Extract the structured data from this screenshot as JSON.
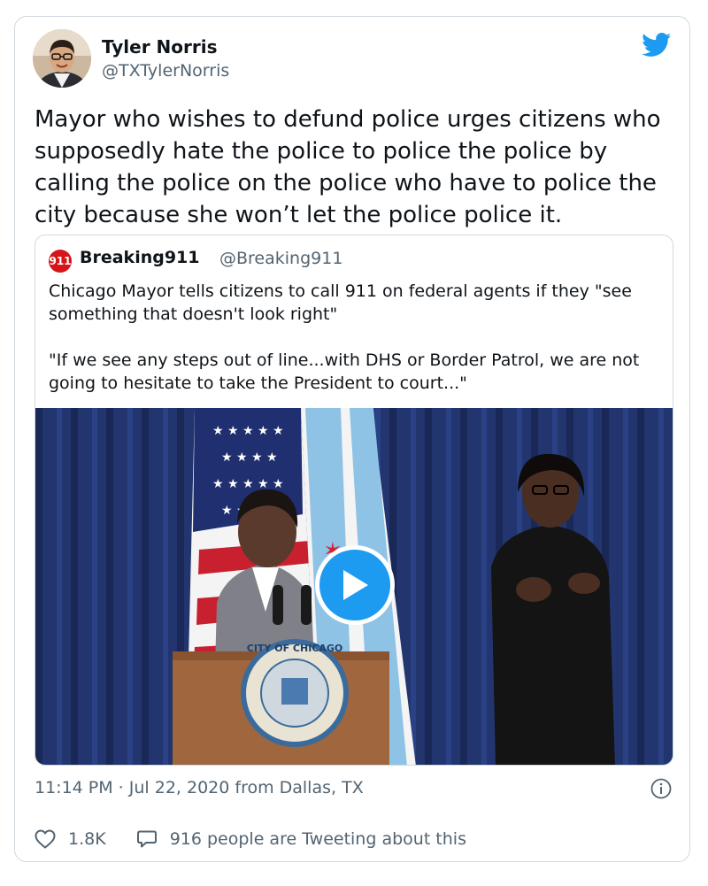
{
  "author": {
    "name": "Tyler Norris",
    "handle": "@TXTylerNorris"
  },
  "tweet": {
    "text": "Mayor who wishes to defund police urges citizens who supposedly hate the police to police the police by calling the police on the police who have to police the city because she won’t let the police police it."
  },
  "quoted": {
    "logo_text": "911",
    "name": "Breaking911",
    "handle": "@Breaking911",
    "text": "Chicago Mayor tells citizens to call 911 on federal agents if they \"see something that doesn't look right\"\n\n\"If we see any steps out of line...with DHS or Border Patrol, we are not going to hesitate to take the President to court...\"",
    "media": {
      "type": "video",
      "seal_text": "CITY OF CHICAGO"
    }
  },
  "meta": {
    "timestamp": "11:14 PM · Jul 22, 2020 from Dallas, TX"
  },
  "actions": {
    "likes": "1.8K",
    "tweeting": "916 people are Tweeting about this"
  },
  "colors": {
    "accent": "#1d9bf0",
    "secondary_text": "#536471",
    "border": "#cfd9de"
  },
  "icons": [
    "twitter-bird-icon",
    "play-icon",
    "info-icon",
    "heart-icon",
    "comment-bubble-icon"
  ]
}
